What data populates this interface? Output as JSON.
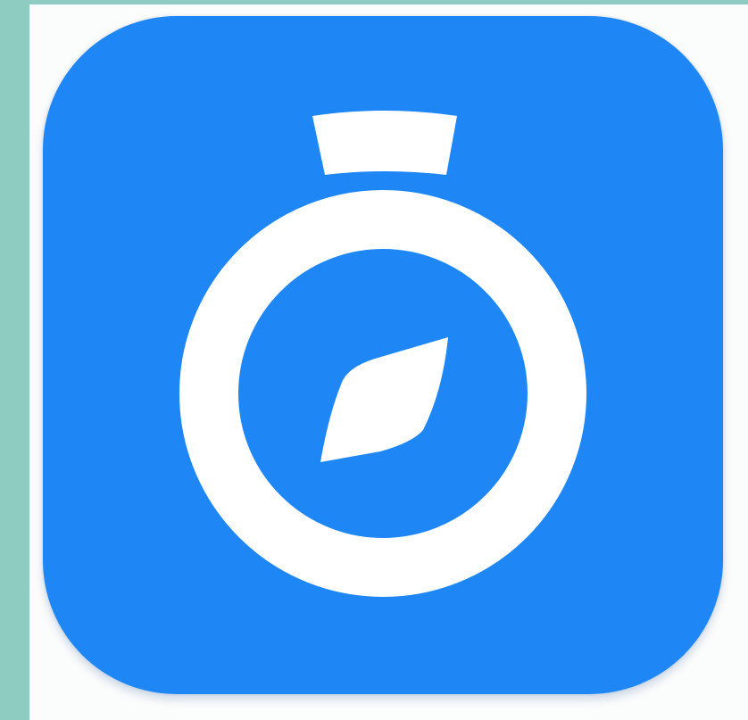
{
  "icon": {
    "name": "stopwatch-compass-icon",
    "background_color": "#1e87f5",
    "glyph_color": "#ffffff"
  },
  "page": {
    "background_color": "#fbfcfc",
    "frame_color": "#8ecbc1"
  }
}
